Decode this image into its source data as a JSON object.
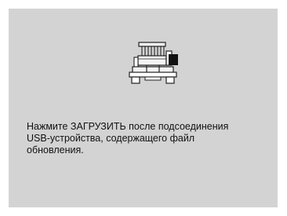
{
  "screen": {
    "background_color": "#d3d3d3",
    "icon": "embroidery-machine-icon",
    "message_lines": [
      "Нажмите ЗАГРУЗИТЬ после подсоединения",
      "USB-устройства, содержащего файл",
      "обновления."
    ]
  }
}
